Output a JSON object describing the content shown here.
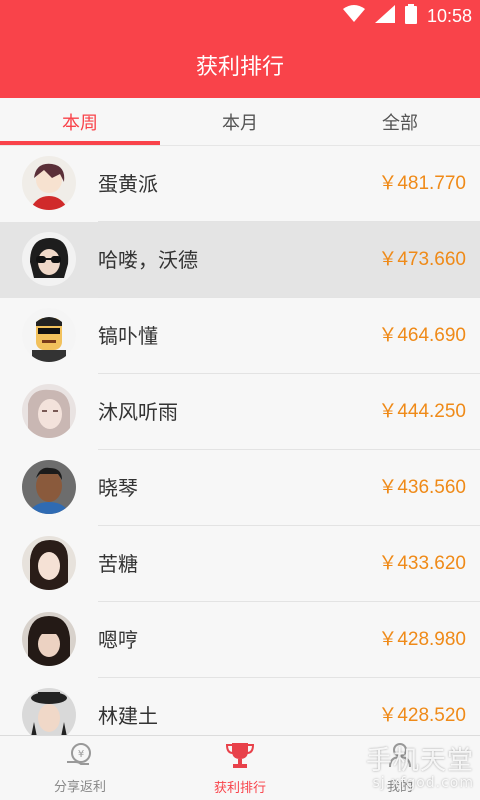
{
  "status_bar": {
    "time": "10:58",
    "icons": [
      "wifi-icon",
      "signal-icon",
      "battery-icon"
    ]
  },
  "header": {
    "title": "获利排行"
  },
  "tabs": [
    {
      "label": "本周",
      "active": true
    },
    {
      "label": "本月",
      "active": false
    },
    {
      "label": "全部",
      "active": false
    }
  ],
  "ranking": [
    {
      "name": "蛋黄派",
      "amount": "￥481.770"
    },
    {
      "name": "哈喽，沃德",
      "amount": "￥473.660"
    },
    {
      "name": "镐卟懂",
      "amount": "￥464.690"
    },
    {
      "name": "沐风听雨",
      "amount": "￥444.250"
    },
    {
      "name": "晓琴",
      "amount": "￥436.560"
    },
    {
      "name": "苦糖",
      "amount": "￥433.620"
    },
    {
      "name": "嗯哼",
      "amount": "￥428.980"
    },
    {
      "name": "林建土",
      "amount": "￥428.520"
    }
  ],
  "bottom_nav": [
    {
      "label": "分享返利",
      "icon": "share-rebate-icon"
    },
    {
      "label": "获利排行",
      "icon": "trophy-icon",
      "active": true
    },
    {
      "label": "我的",
      "icon": "profile-icon"
    }
  ],
  "watermark": {
    "main": "手机天堂",
    "sub": "sj.xfgod.com"
  },
  "colors": {
    "primary": "#f9434a",
    "amount": "#ef8a18"
  }
}
